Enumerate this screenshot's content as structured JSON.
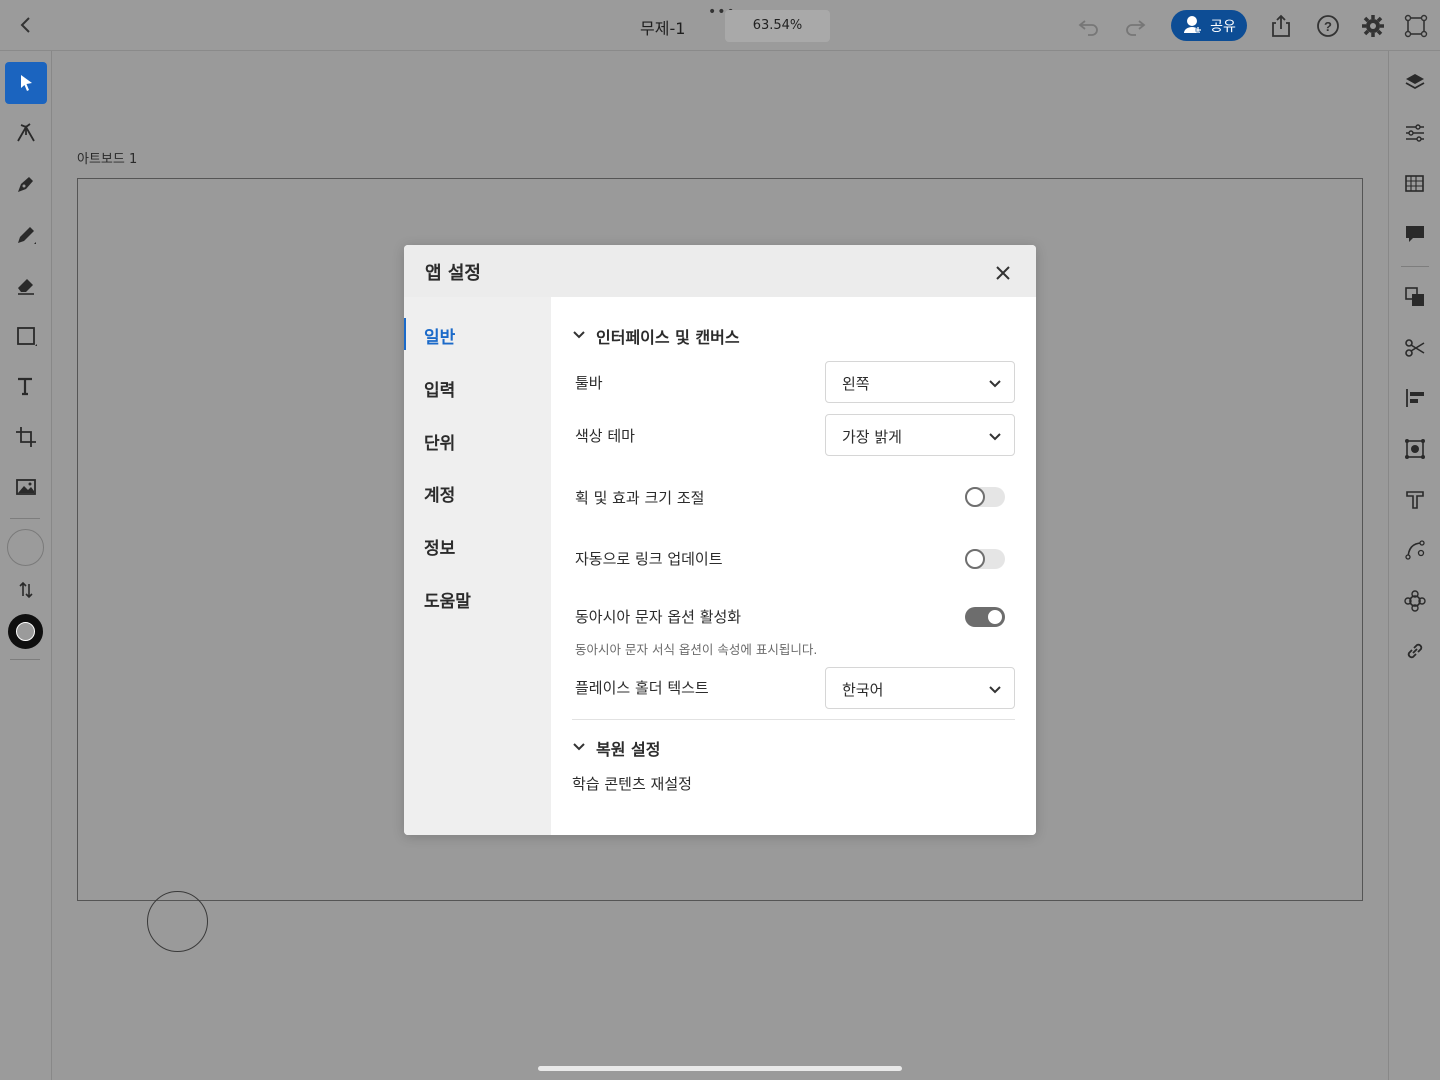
{
  "topbar": {
    "title": "무제-1",
    "more": "•••",
    "zoom": "63.54%",
    "share_label": "공유",
    "accent": "#0d4d95"
  },
  "left_toolbar": {
    "tools": [
      "select-icon",
      "direct-select-icon",
      "pen-icon",
      "pencil-icon",
      "eraser-icon",
      "rectangle-icon",
      "type-icon",
      "transform-icon",
      "image-icon"
    ],
    "active_tool": "select-icon",
    "active_color": "#1b64bf"
  },
  "right_panel": {
    "tools": [
      "layers-icon",
      "properties-icon",
      "libraries-icon",
      "comments-icon",
      "arrange-icon",
      "cut-icon",
      "align-icon",
      "repeat-icon",
      "type-panel-icon",
      "path-icon",
      "effects-icon",
      "link-icon"
    ]
  },
  "canvas": {
    "artboard_label": "아트보드 1"
  },
  "modal": {
    "title": "앱 설정",
    "nav": [
      {
        "label": "일반",
        "active": true
      },
      {
        "label": "입력"
      },
      {
        "label": "단위"
      },
      {
        "label": "계정"
      },
      {
        "label": "정보"
      },
      {
        "label": "도움말"
      }
    ],
    "section_interface": {
      "heading": "인터페이스 및 캔버스",
      "toolbar_label": "툴바",
      "toolbar_value": "왼쪽",
      "theme_label": "색상 테마",
      "theme_value": "가장 밝게",
      "scale_label": "획 및 효과 크기 조절",
      "scale_on": false,
      "autolink_label": "자동으로 링크 업데이트",
      "autolink_on": false,
      "eastasian_label": "동아시아 문자 옵션 활성화",
      "eastasian_on": true,
      "eastasian_hint": "동아시아 문자 서식 옵션이 속성에 표시됩니다.",
      "placeholder_label": "플레이스 홀더 텍스트",
      "placeholder_value": "한국어"
    },
    "section_reset": {
      "heading": "복원 설정",
      "reset_learn": "학습 콘텐츠 재설정"
    },
    "nav_active_color": "#1b6ac9"
  }
}
